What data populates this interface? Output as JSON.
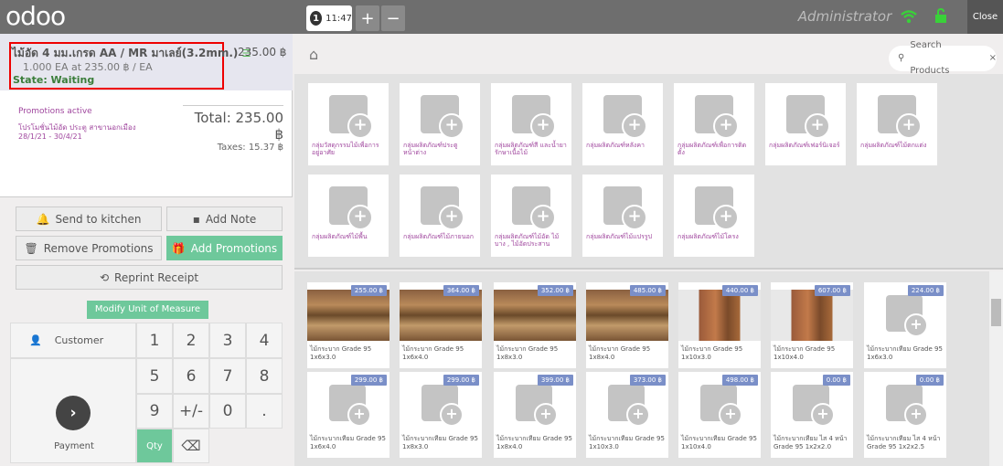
{
  "topbar": {
    "logo": "odoo",
    "order_number": "1",
    "order_time": "11:47",
    "add_icon": "+",
    "remove_icon": "−",
    "user": "Administrator",
    "close_label": "Close"
  },
  "orderline": {
    "product": "ไม้อัด 4 มม.เกรด AA / MR มาเลย์(3.2mm.)",
    "price": "235.00 ฿",
    "qty_line": "1.000 EA at 235.00 ฿ / EA",
    "state": "State: Waiting"
  },
  "promotions": {
    "title": "Promotions active",
    "name": "โปรโมชั่นไม้อัด ประตู สาขานอกเมือง 28/1/21 - 30/4/21"
  },
  "totals": {
    "total": "Total: 235.00 ฿",
    "taxes": "Taxes: 15.37 ฿"
  },
  "controls": {
    "send_kitchen": "Send to kitchen",
    "add_note": "Add Note",
    "remove_promotions": "Remove Promotions",
    "add_promotions": "Add Promotions",
    "reprint": "Reprint Receipt",
    "modify_uom": "Modify Unit of Measure",
    "customer": "Customer",
    "payment": "Payment",
    "payment_icon": "›",
    "keys": [
      "1",
      "2",
      "3",
      "4",
      "5",
      "6",
      "7",
      "8",
      "9",
      "+/-",
      "0",
      "."
    ],
    "qty": "Qty",
    "backspace": "⌫"
  },
  "search": {
    "placeholder": "Search Products",
    "clear": "×"
  },
  "categories": [
    "กลุ่มวัสดุกรรมไม้เพื่อการอยู่อาศัย",
    "กลุ่มผลิตภัณฑ์ประตู หน้าต่าง",
    "กลุ่มผลิตภัณฑ์สี และน้ำยารักษาเนื้อไม้",
    "กลุ่มผลิตภัณฑ์หลังคา",
    "กลุ่มผลิตภัณฑ์เพื่อการติดตั้ง",
    "กลุ่มผลิตภัณฑ์เฟอร์นิเจอร์",
    "กลุ่มผลิตภัณฑ์ไม้ตกแต่ง",
    "กลุ่มผลิตภัณฑ์ไม้พื้น",
    "กลุ่มผลิตภัณฑ์ไม้ภายนอก",
    "กลุ่มผลิตภัณฑ์ไม้อัด ไม้บาง , ไม้อัดประสาน",
    "กลุ่มผลิตภัณฑ์ไม้แปรรูป",
    "กลุ่มผลิตภัณฑ์ไม้โครง"
  ],
  "products": [
    {
      "name": "ไม้กระบาก Grade 95 1x6x3.0",
      "price": "255.00 ฿",
      "img": "wood"
    },
    {
      "name": "ไม้กระบาก Grade 95 1x6x4.0",
      "price": "364.00 ฿",
      "img": "wood"
    },
    {
      "name": "ไม้กระบาก Grade 95 1x8x3.0",
      "price": "352.00 ฿",
      "img": "wood"
    },
    {
      "name": "ไม้กระบาก Grade 95 1x8x4.0",
      "price": "485.00 ฿",
      "img": "wood"
    },
    {
      "name": "ไม้กระบาก Grade 95 1x10x3.0",
      "price": "440.00 ฿",
      "img": "woodv"
    },
    {
      "name": "ไม้กระบาก Grade 95 1x10x4.0",
      "price": "607.00 ฿",
      "img": "woodv"
    },
    {
      "name": "ไม้กระบากเทียม Grade 95 1x6x3.0",
      "price": "224.00 ฿",
      "img": "ph"
    },
    {
      "name": "ไม้กระบากเทียม Grade 95 1x6x4.0",
      "price": "299.00 ฿",
      "img": "ph"
    },
    {
      "name": "ไม้กระบากเทียม Grade 95 1x8x3.0",
      "price": "299.00 ฿",
      "img": "ph"
    },
    {
      "name": "ไม้กระบากเทียม Grade 95 1x8x4.0",
      "price": "399.00 ฿",
      "img": "ph"
    },
    {
      "name": "ไม้กระบากเทียม Grade 95 1x10x3.0",
      "price": "373.00 ฿",
      "img": "ph"
    },
    {
      "name": "ไม้กระบากเทียม Grade 95 1x10x4.0",
      "price": "498.00 ฿",
      "img": "ph"
    },
    {
      "name": "ไม้กระบากเทียม ไส 4 หน้า Grade 95 1x2x2.0",
      "price": "0.00 ฿",
      "img": "ph"
    },
    {
      "name": "ไม้กระบากเทียม ไส 4 หน้า Grade 95 1x2x2.5",
      "price": "0.00 ฿",
      "img": "ph"
    }
  ]
}
